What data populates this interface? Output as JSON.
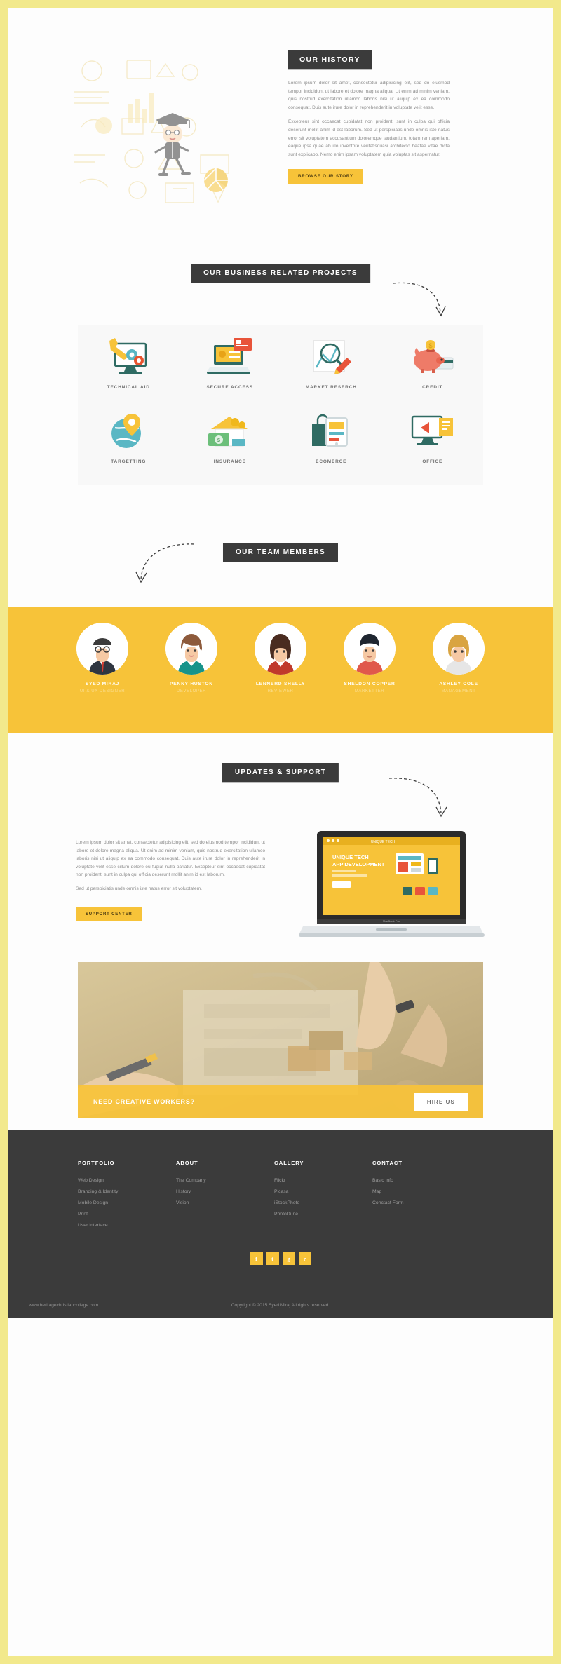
{
  "theme": {
    "accent": "#f7c339",
    "dark": "#3b3b3b",
    "page_border": "#f2e98c",
    "body_text": "#8d8d8d"
  },
  "history": {
    "heading": "OUR HISTORY",
    "paragraphs": [
      "Lorem ipsum dolor sit amet, consectetur adipisicing elit, sed do eiusmod tempor incididunt ut labore et dolore magna aliqua. Ut enim ad minim veniam, quis nostrud exercitation ullamco laboris nisi ut aliquip ex ea commodo consequat. Duis aute irure dolor in reprehenderit in voluptate velit esse.",
      "Excepteur sint occaecat cupidatat non proident, sunt in culpa qui officia deserunt mollit anim id est laborum. Sed ut perspiciatis unde omnis iste natus error sit voluptatem accusantium doloremque laudantium. totam rem aperiam, eaque ipsa quae ab illo inventore veritatisquasi architecto beatae vitae dicta sunt explicabo. Nemo enim ipsam voluptatem quia voluptas sit aspernatur."
    ],
    "button": "BROWSE OUR STORY"
  },
  "projects": {
    "heading": "OUR BUSINESS RELATED PROJECTS",
    "items": [
      {
        "label": "TECHNICAL AID",
        "icon": "monitor-wrench-gears-icon"
      },
      {
        "label": "SECURE ACCESS",
        "icon": "laptop-login-card-icon"
      },
      {
        "label": "MARKET RESERCH",
        "icon": "magnifier-chart-pencil-icon"
      },
      {
        "label": "CREDIT",
        "icon": "piggy-bank-coin-icon"
      },
      {
        "label": "TARGETTING",
        "icon": "location-pin-globe-icon"
      },
      {
        "label": "INSURANCE",
        "icon": "house-money-icon"
      },
      {
        "label": "ECOMERCE",
        "icon": "shopping-bag-mobile-icon"
      },
      {
        "label": "OFFICE",
        "icon": "monitor-presentation-icon"
      }
    ]
  },
  "team": {
    "heading": "OUR TEAM MEMBERS",
    "members": [
      {
        "name": "SYED MIRAJ",
        "role": "UI & UX DESIGNER"
      },
      {
        "name": "PENNY HUSTON",
        "role": "DEVELOPER"
      },
      {
        "name": "LENNERD SHELLY",
        "role": "REVIEWER"
      },
      {
        "name": "SHELDON COPPER",
        "role": "MARKETTER"
      },
      {
        "name": "ASHLEY COLE",
        "role": "MANAGEMENT"
      }
    ]
  },
  "support": {
    "heading": "UPDATES & SUPPORT",
    "paragraphs": [
      "Lorem ipsum dolor sit amet, consectetur adipisicing elit, sed do eiusmod tempor incididunt ut labore et dolore magna aliqua. Ut enim ad minim veniam, quis nostrud exercitation ullamco laboris nisi ut aliquip ex ea commodo consequat. Duis aute irure dolor in reprehenderit in voluptate velit esse cillum dolore eu fugiat nulla pariatur. Excepteur sint occaecat cupidatat non proident, sunt in culpa qui officia deserunt mollit anim id est laborum.",
      "Sed ut perspiciatis unde omnis iste natus error sit voluptatem."
    ],
    "button": "SUPPORT CENTER",
    "laptop_screen_title": "UNIQUE TECH APP DEVELOPMENT"
  },
  "banner": {
    "text": "NEED CREATIVE WORKERS?",
    "button": "HIRE US"
  },
  "footer": {
    "columns": [
      {
        "title": "PORTFOLIO",
        "links": [
          "Web Design",
          "Branding & Identity",
          "Mobile Design",
          "Print",
          "User Interface"
        ]
      },
      {
        "title": "ABOUT",
        "links": [
          "The Company",
          "History",
          "Vision"
        ]
      },
      {
        "title": "GALLERY",
        "links": [
          "Flickr",
          "Picasa",
          "iStockPhoto",
          "PhotoDune"
        ]
      },
      {
        "title": "CONTACT",
        "links": [
          "Basic Info",
          "Map",
          "Conctact Form"
        ]
      }
    ],
    "socials": [
      {
        "name": "facebook-icon",
        "glyph": "f"
      },
      {
        "name": "twitter-icon",
        "glyph": "t"
      },
      {
        "name": "google-plus-icon",
        "glyph": "g"
      },
      {
        "name": "rss-icon",
        "glyph": "r"
      }
    ],
    "website": "www.heritagechristiancollege.com",
    "copyright": "Copyright © 2015 Syed Miraj All rights reserved."
  }
}
